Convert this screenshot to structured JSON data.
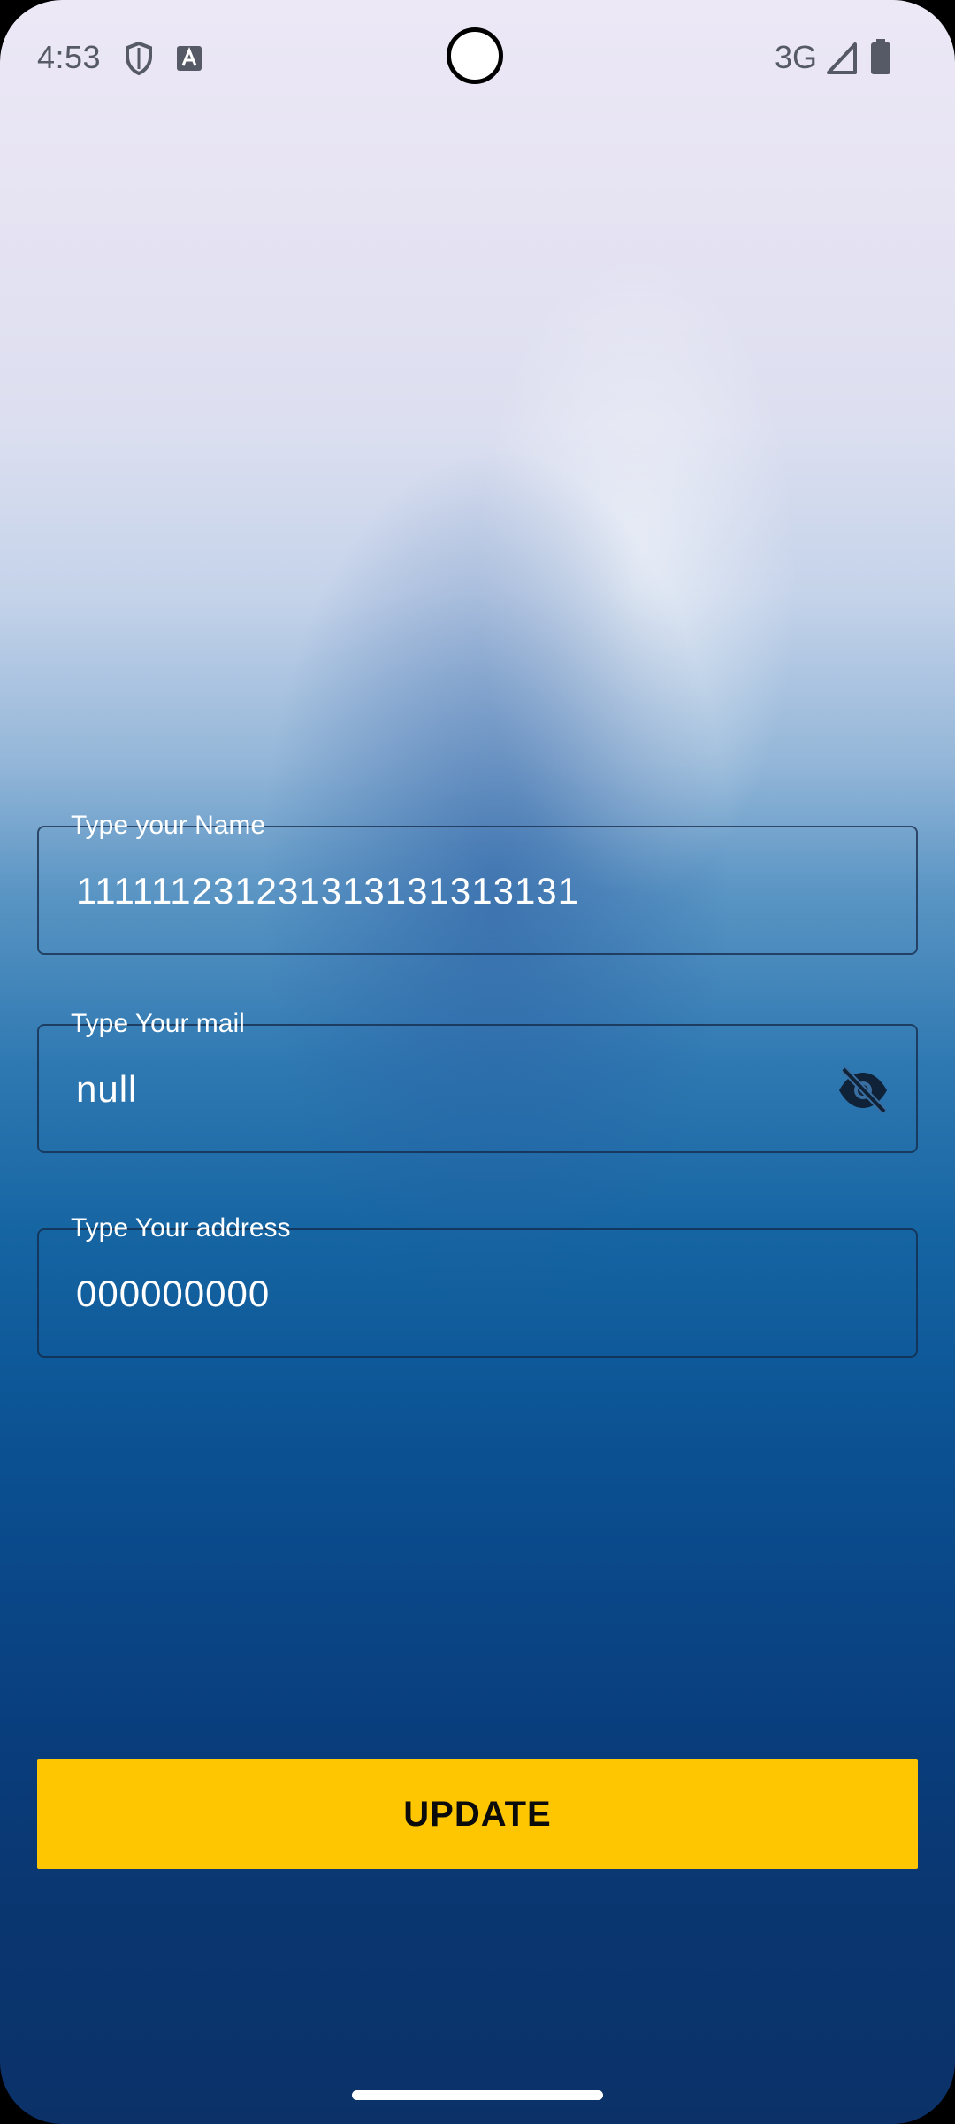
{
  "status_bar": {
    "time": "4:53",
    "network": "3G",
    "icons": [
      "shield-icon",
      "font-a-icon",
      "signal-icon",
      "battery-icon"
    ]
  },
  "form": {
    "name": {
      "label": "Type your Name",
      "value": "111111231231313131313131"
    },
    "mail": {
      "label": "Type Your mail",
      "value": "null",
      "toggle_icon": "eye-off-icon"
    },
    "address": {
      "label": "Type Your address",
      "value": "000000000"
    }
  },
  "actions": {
    "update_label": "UPDATE"
  },
  "colors": {
    "button": "#fdc600",
    "field_label": "#ffffff",
    "field_border": "#14284a"
  }
}
